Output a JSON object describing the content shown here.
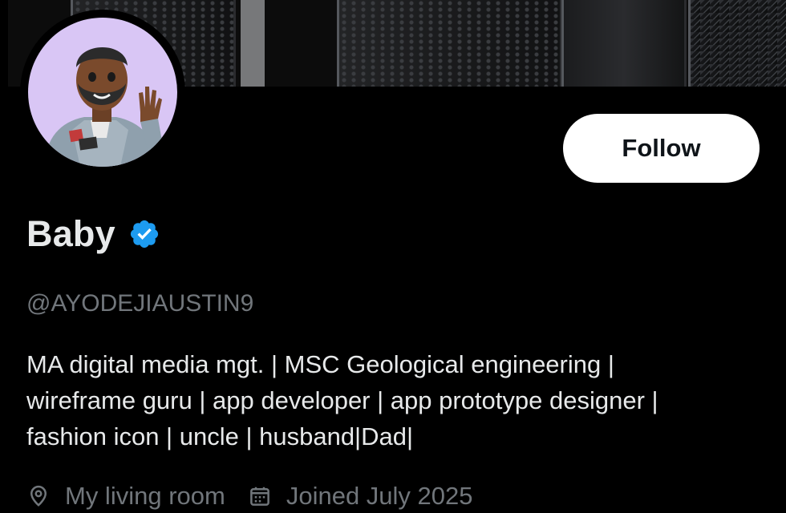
{
  "profile": {
    "display_name": "Baby",
    "handle": "@AYODEJIAUSTIN9",
    "verified": true,
    "bio_lines": [
      "MA digital media mgt. | MSC Geological engineering |",
      "wireframe guru | app developer | app prototype designer |",
      "fashion icon | uncle | husband|Dad|"
    ],
    "location": "My living room",
    "joined": "Joined July 2025"
  },
  "actions": {
    "follow_label": "Follow"
  },
  "icons": {
    "verified": "verified-badge-icon",
    "location": "location-pin-icon",
    "calendar": "calendar-icon"
  },
  "colors": {
    "background": "#000000",
    "primary_text": "#e7e9ea",
    "secondary_text": "#71767b",
    "verified_blue": "#1d9bf0",
    "button_bg": "#ffffff",
    "button_text": "#0f1419",
    "avatar_bg": "#d9c6f5"
  }
}
